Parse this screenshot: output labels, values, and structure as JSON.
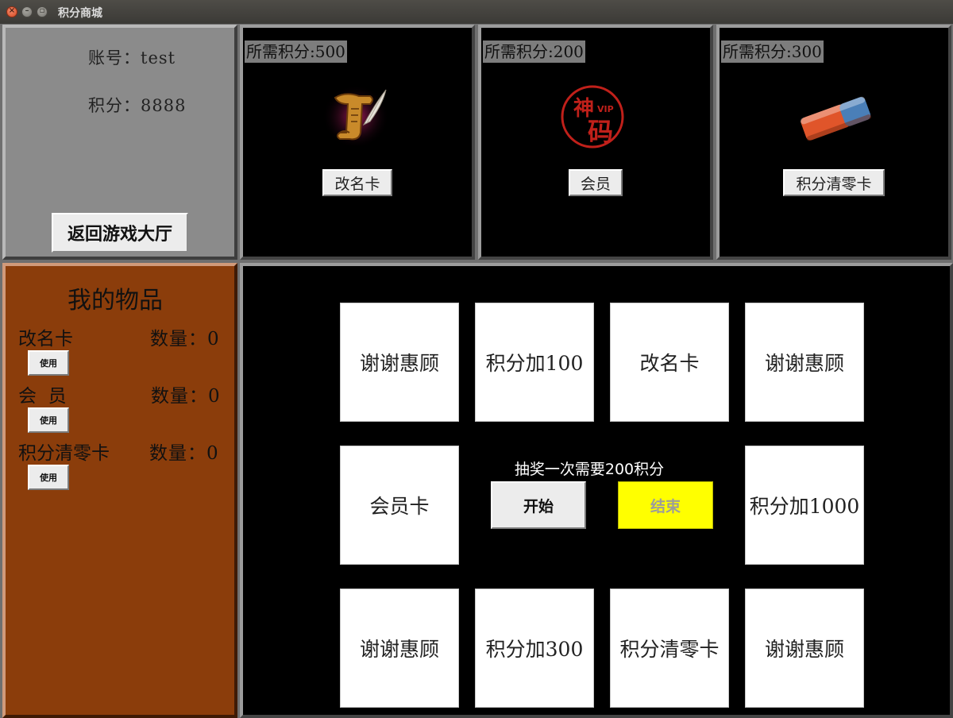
{
  "window": {
    "title": "积分商城",
    "close_glyph": "×",
    "min_glyph": "–",
    "max_glyph": "▫"
  },
  "account": {
    "line1": "账号：test",
    "line2": "积分：8888",
    "back_button": "返回游戏大厅"
  },
  "shop": [
    {
      "price": "所需积分:500",
      "label": "改名卡",
      "icon": "scroll-quill-icon"
    },
    {
      "price": "所需积分:200",
      "label": "会员",
      "icon": "vip-seal-icon",
      "seal_text": "神",
      "seal_text2": "码",
      "seal_badge": "VIP"
    },
    {
      "price": "所需积分:300",
      "label": "积分清零卡",
      "icon": "eraser-icon"
    }
  ],
  "items": {
    "title": "我的物品",
    "list": [
      {
        "name": "改名卡",
        "qty": "数量：0",
        "use": "使用"
      },
      {
        "name": "会  员",
        "qty": "数量：0",
        "use": "使用"
      },
      {
        "name": "积分清零卡",
        "qty": "数量：0",
        "use": "使用"
      }
    ]
  },
  "lottery": {
    "prizes": [
      "谢谢惠顾",
      "积分加100",
      "改名卡",
      "谢谢惠顾",
      "会员卡",
      "积分加1000",
      "谢谢惠顾",
      "积分加300",
      "积分清零卡",
      "谢谢惠顾"
    ],
    "note": "抽奖一次需要200积分",
    "start": "开始",
    "end": "结束"
  },
  "colors": {
    "items_bg": "#8b3d0b",
    "end_button": "#ffff00"
  }
}
